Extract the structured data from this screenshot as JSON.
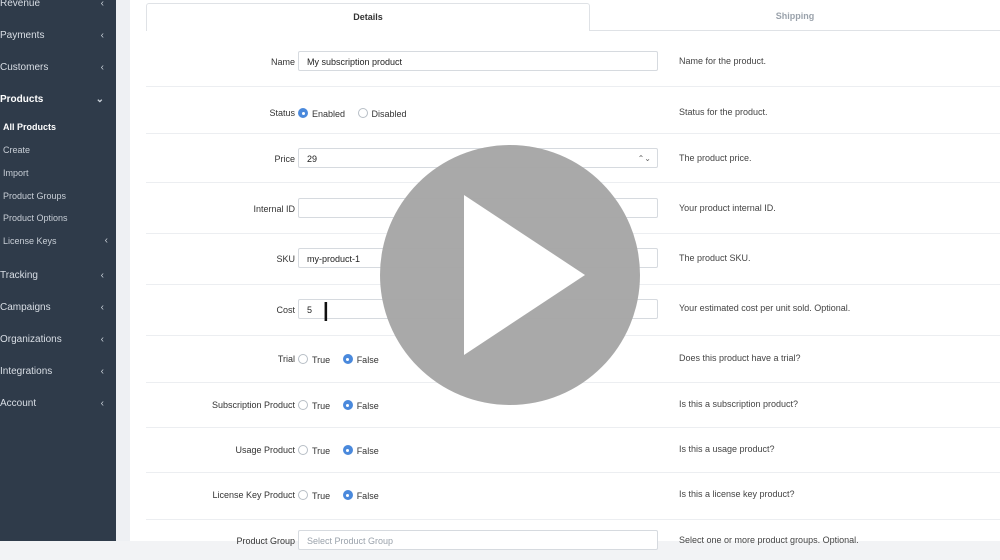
{
  "sidebar": {
    "items": [
      {
        "label": "Revenue"
      },
      {
        "label": "Payments"
      },
      {
        "label": "Customers"
      },
      {
        "label": "Products"
      },
      {
        "label": "Tracking"
      },
      {
        "label": "Campaigns"
      },
      {
        "label": "Organizations"
      },
      {
        "label": "Integrations"
      },
      {
        "label": "Account"
      }
    ],
    "products_sub": [
      {
        "label": "All Products"
      },
      {
        "label": "Create"
      },
      {
        "label": "Import"
      },
      {
        "label": "Product Groups"
      },
      {
        "label": "Product Options"
      },
      {
        "label": "License Keys"
      }
    ],
    "chevron_left": "‹",
    "chevron_down": "⌄"
  },
  "tabs": {
    "details": "Details",
    "shipping": "Shipping"
  },
  "form": {
    "name": {
      "label": "Name",
      "value": "My subscription product",
      "help": "Name for the product."
    },
    "status": {
      "label": "Status",
      "opt1": "Enabled",
      "opt2": "Disabled",
      "help": "Status for the product."
    },
    "price": {
      "label": "Price",
      "value": "29",
      "help": "The product price."
    },
    "internal_id": {
      "label": "Internal ID",
      "value": "",
      "help": "Your product internal ID."
    },
    "sku": {
      "label": "SKU",
      "value": "my-product-1",
      "help": "The product SKU."
    },
    "cost": {
      "label": "Cost",
      "value": "5",
      "help": "Your estimated cost per unit sold. Optional."
    },
    "trial": {
      "label": "Trial",
      "opt1": "True",
      "opt2": "False",
      "help": "Does this product have a trial?"
    },
    "subscription": {
      "label": "Subscription Product",
      "opt1": "True",
      "opt2": "False",
      "help": "Is this a subscription product?"
    },
    "usage": {
      "label": "Usage Product",
      "opt1": "True",
      "opt2": "False",
      "help": "Is this a usage product?"
    },
    "license": {
      "label": "License Key Product",
      "opt1": "True",
      "opt2": "False",
      "help": "Is this a license key product?"
    },
    "group": {
      "label": "Product Group",
      "placeholder": "Select Product Group",
      "help": "Select one or more product groups. Optional."
    }
  },
  "spinner_glyph": "⌃⌄",
  "cursor_glyph": "I",
  "colors": {
    "sidebar": "#2f3b4a",
    "accent": "#4a89dc",
    "play_overlay": "#a6a6a6"
  }
}
